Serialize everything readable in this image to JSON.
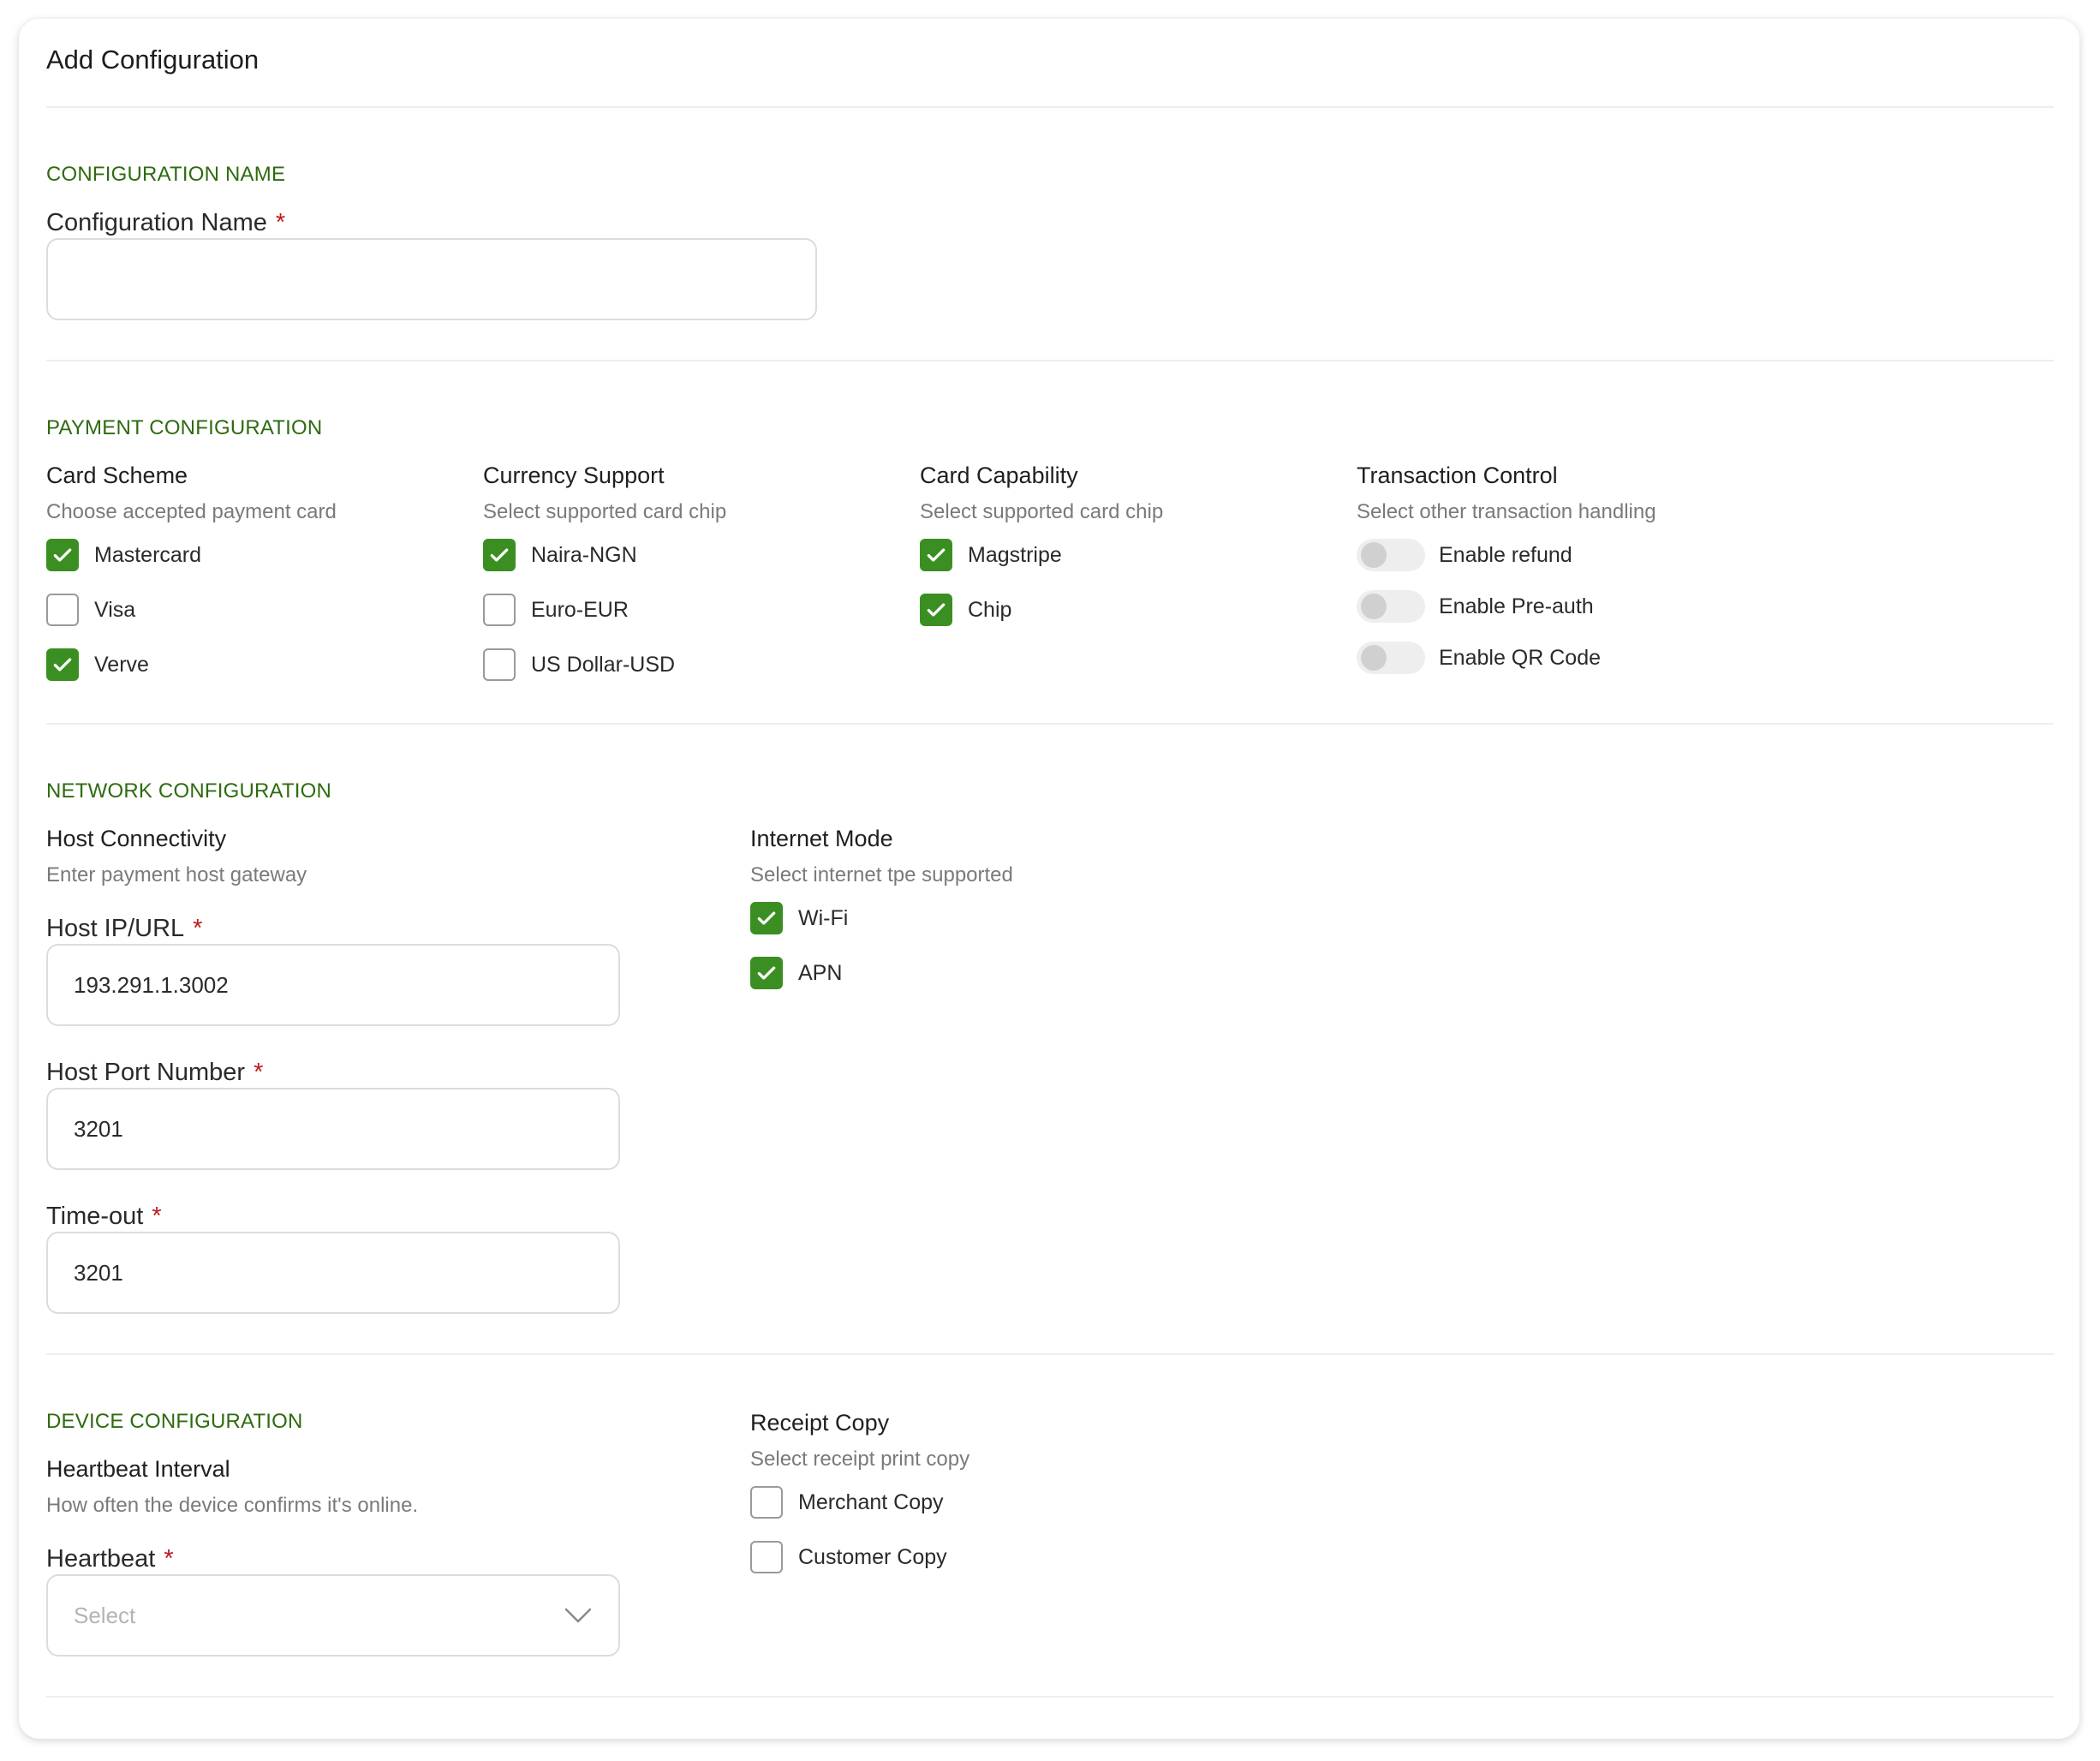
{
  "title": "Add Configuration",
  "sections": {
    "config_name": {
      "heading": "CONFIGURATION NAME",
      "label": "Configuration Name",
      "required": "*",
      "value": ""
    },
    "payment": {
      "heading": "PAYMENT CONFIGURATION",
      "card_scheme": {
        "title": "Card Scheme",
        "subtitle": "Choose accepted payment card",
        "options": [
          {
            "label": "Mastercard",
            "checked": true
          },
          {
            "label": "Visa",
            "checked": false
          },
          {
            "label": "Verve",
            "checked": true
          }
        ]
      },
      "currency": {
        "title": "Currency Support",
        "subtitle": "Select supported card chip",
        "options": [
          {
            "label": "Naira-NGN",
            "checked": true
          },
          {
            "label": "Euro-EUR",
            "checked": false
          },
          {
            "label": "US Dollar-USD",
            "checked": false
          }
        ]
      },
      "capability": {
        "title": "Card Capability",
        "subtitle": "Select supported card chip",
        "options": [
          {
            "label": "Magstripe",
            "checked": true
          },
          {
            "label": "Chip",
            "checked": true
          }
        ]
      },
      "transaction": {
        "title": "Transaction Control",
        "subtitle": "Select other transaction handling",
        "toggles": [
          {
            "label": "Enable refund",
            "on": false
          },
          {
            "label": "Enable Pre-auth",
            "on": false
          },
          {
            "label": "Enable QR Code",
            "on": false
          }
        ]
      }
    },
    "network": {
      "heading": "NETWORK CONFIGURATION",
      "host": {
        "title": "Host Connectivity",
        "subtitle": "Enter payment host gateway",
        "host_ip_label": "Host IP/URL",
        "host_ip_value": "193.291.1.3002",
        "port_label": "Host Port Number",
        "port_value": "3201",
        "timeout_label": "Time-out",
        "timeout_value": "3201",
        "required": "*"
      },
      "internet": {
        "title": "Internet Mode",
        "subtitle": "Select internet tpe supported",
        "options": [
          {
            "label": "Wi-Fi",
            "checked": true
          },
          {
            "label": "APN",
            "checked": true
          }
        ]
      }
    },
    "device": {
      "heading": "DEVICE CONFIGURATION",
      "heartbeat": {
        "title": "Heartbeat Interval",
        "subtitle": "How often the device confirms it's online.",
        "label": "Heartbeat",
        "required": "*",
        "placeholder": "Select"
      },
      "receipt": {
        "title": "Receipt Copy",
        "subtitle": "Select receipt print copy",
        "options": [
          {
            "label": "Merchant Copy",
            "checked": false
          },
          {
            "label": "Customer Copy",
            "checked": false
          }
        ]
      }
    }
  },
  "colors": {
    "accent": "#3b8f22",
    "section_heading": "#2e6b0f",
    "required": "#c0181b"
  }
}
